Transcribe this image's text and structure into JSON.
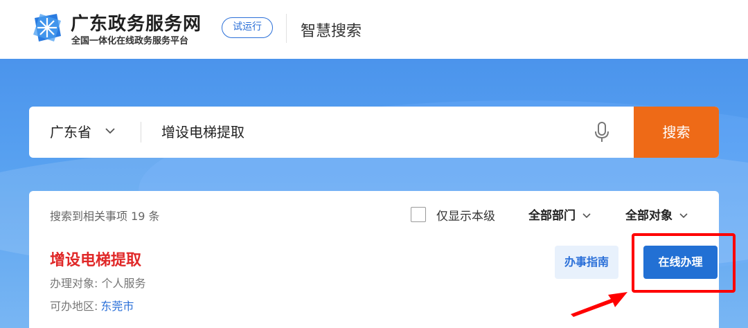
{
  "header": {
    "site_title": "广东政务服务网",
    "site_subtitle": "全国一体化在线政务服务平台",
    "trial_badge": "试运行",
    "section_title": "智慧搜索"
  },
  "search": {
    "region": "广东省",
    "query": "增设电梯提取",
    "button_label": "搜索",
    "icons": {
      "region_dropdown": "chevron-down-icon",
      "voice": "microphone-icon"
    }
  },
  "results": {
    "count_text": "搜索到相关事项 19 条",
    "only_level_label": "仅显示本级",
    "only_level_checked": false,
    "dept_filter": "全部部门",
    "object_filter": "全部对象",
    "items": [
      {
        "title": "增设电梯提取",
        "object_label": "办理对象:",
        "object_value": "个人服务",
        "area_label": "可办地区:",
        "area_value": "东莞市",
        "guide_label": "办事指南",
        "online_label": "在线办理"
      }
    ]
  },
  "colors": {
    "accent_orange": "#ee6a17",
    "primary_blue": "#2270d4",
    "title_red": "#e02828",
    "highlight_red": "#ff0000"
  }
}
